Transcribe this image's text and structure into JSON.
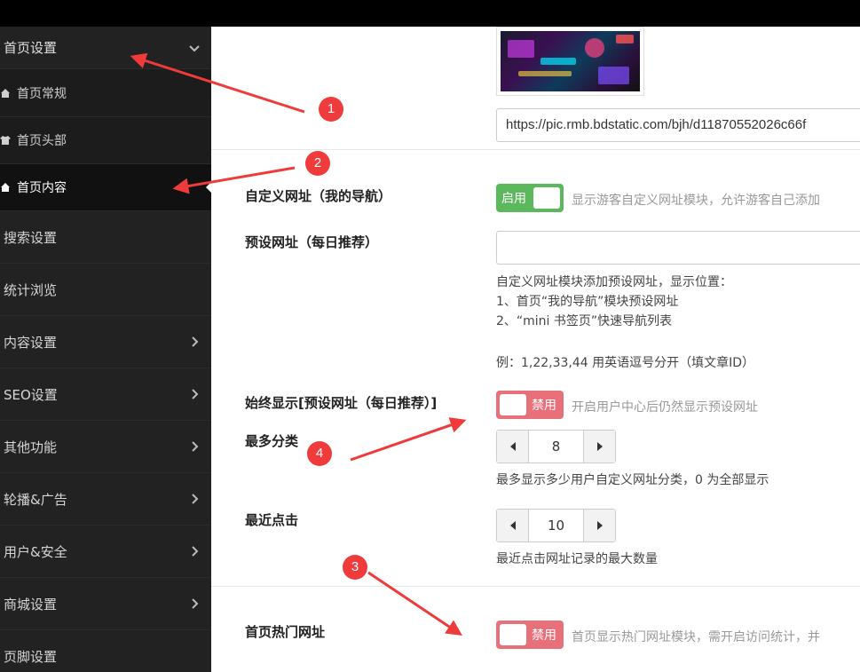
{
  "sidebar": {
    "top_item": "首页设置",
    "sub_items": [
      {
        "label": "首页常规",
        "icon": "home-icon"
      },
      {
        "label": "首页头部",
        "icon": "shirt-icon"
      },
      {
        "label": "首页内容",
        "icon": "home-icon",
        "active": true
      }
    ],
    "items": [
      {
        "label": "搜索设置",
        "has_chevron": false
      },
      {
        "label": "统计浏览",
        "has_chevron": false
      },
      {
        "label": "内容设置",
        "has_chevron": true
      },
      {
        "label": "SEO设置",
        "has_chevron": true
      },
      {
        "label": "其他功能",
        "has_chevron": true
      },
      {
        "label": "轮播&广告",
        "has_chevron": true
      },
      {
        "label": "用户&安全",
        "has_chevron": true
      },
      {
        "label": "商城设置",
        "has_chevron": true
      },
      {
        "label": "页脚设置",
        "has_chevron": false
      }
    ]
  },
  "main": {
    "image_url": "https://pic.rmb.bdstatic.com/bjh/d11870552026c66f",
    "custom_url": {
      "label": "自定义网址（我的导航）",
      "toggle": "启用",
      "state": "on",
      "desc": "显示游客自定义网址模块，允许游客自己添加"
    },
    "preset_url": {
      "label": "预设网址（每日推荐）",
      "value": "",
      "hint_lines": [
        "自定义网址模块添加预设网址，显示位置：",
        "1、首页“我的导航”模块预设网址",
        "2、“mini 书签页”快速导航列表",
        "",
        "例：1,22,33,44 用英语逗号分开（填文章ID）"
      ]
    },
    "always_show": {
      "label": "始终显示[预设网址（每日推荐）]",
      "toggle": "禁用",
      "state": "off",
      "desc": "开启用户中心后仍然显示预设网址"
    },
    "max_category": {
      "label": "最多分类",
      "value": "8",
      "hint": "最多显示多少用户自定义网址分类，0 为全部显示"
    },
    "recent_click": {
      "label": "最近点击",
      "value": "10",
      "hint": "最近点击网址记录的最大数量"
    },
    "hot_url": {
      "label": "首页热门网址",
      "toggle": "禁用",
      "state": "off",
      "desc": "首页显示热门网址模块，需开启访问统计，并"
    }
  },
  "annotations": {
    "badges": [
      "1",
      "2",
      "3",
      "4"
    ],
    "color": "#ef3b3b"
  }
}
